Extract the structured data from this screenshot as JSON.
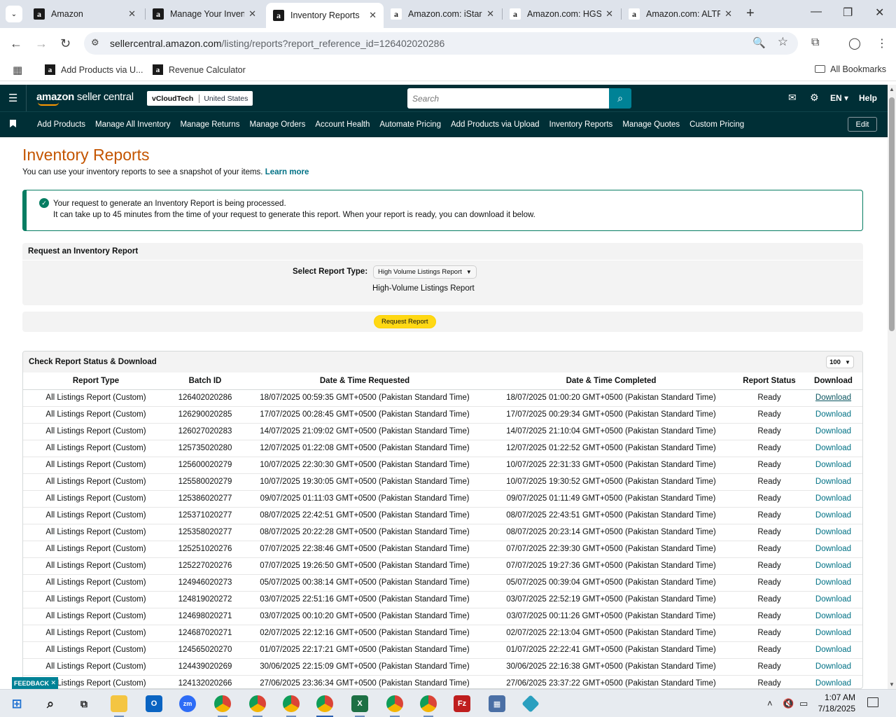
{
  "browser": {
    "tabs": [
      {
        "label": "Amazon",
        "active": false
      },
      {
        "label": "Manage Your Inventory",
        "active": false
      },
      {
        "label": "Inventory Reports",
        "active": true
      },
      {
        "label": "Amazon.com: iStar",
        "active": false
      },
      {
        "label": "Amazon.com: HGS",
        "active": false
      },
      {
        "label": "Amazon.com: ALTR",
        "active": false
      }
    ],
    "url_domain": "sellercentral.amazon.com",
    "url_path": "/listing/reports?report_reference_id=126402020286",
    "bookmarks": [
      "Add Products via U...",
      "Revenue Calculator"
    ],
    "all_bookmarks": "All Bookmarks"
  },
  "header": {
    "logo_bold": "amazon",
    "logo_thin": " seller central",
    "account_name": "vCloudTech",
    "marketplace": "United States",
    "search_placeholder": "Search",
    "language": "EN",
    "help": "Help"
  },
  "nav": {
    "items": [
      "Add Products",
      "Manage All Inventory",
      "Manage Returns",
      "Manage Orders",
      "Account Health",
      "Automate Pricing",
      "Add Products via Upload",
      "Inventory Reports",
      "Manage Quotes",
      "Custom Pricing"
    ],
    "edit": "Edit"
  },
  "page": {
    "title": "Inventory Reports",
    "subtitle": "You can use your inventory reports to see a snapshot of your items.",
    "learn_more": "Learn more",
    "alert_line1": "Your request to generate an Inventory Report is being processed.",
    "alert_line2": "It can take up to 45 minutes from the time of your request to generate this report. When your report is ready, you can download it below.",
    "request_heading": "Request an Inventory Report",
    "select_label": "Select Report Type:",
    "select_value": "High Volume Listings Report",
    "report_description": "High-Volume Listings Report",
    "request_button": "Request Report",
    "status_heading": "Check Report Status & Download",
    "page_size": "100",
    "feedback": "FEEDBACK"
  },
  "table": {
    "columns": [
      "Report Type",
      "Batch ID",
      "Date & Time Requested",
      "Date & Time Completed",
      "Report Status",
      "Download"
    ],
    "rows": [
      [
        "All Listings Report (Custom)",
        "126402020286",
        "18/07/2025 00:59:35 GMT+0500 (Pakistan Standard Time)",
        "18/07/2025 01:00:20 GMT+0500 (Pakistan Standard Time)",
        "Ready",
        "Download"
      ],
      [
        "All Listings Report (Custom)",
        "126290020285",
        "17/07/2025 00:28:45 GMT+0500 (Pakistan Standard Time)",
        "17/07/2025 00:29:34 GMT+0500 (Pakistan Standard Time)",
        "Ready",
        "Download"
      ],
      [
        "All Listings Report (Custom)",
        "126027020283",
        "14/07/2025 21:09:02 GMT+0500 (Pakistan Standard Time)",
        "14/07/2025 21:10:04 GMT+0500 (Pakistan Standard Time)",
        "Ready",
        "Download"
      ],
      [
        "All Listings Report (Custom)",
        "125735020280",
        "12/07/2025 01:22:08 GMT+0500 (Pakistan Standard Time)",
        "12/07/2025 01:22:52 GMT+0500 (Pakistan Standard Time)",
        "Ready",
        "Download"
      ],
      [
        "All Listings Report (Custom)",
        "125600020279",
        "10/07/2025 22:30:30 GMT+0500 (Pakistan Standard Time)",
        "10/07/2025 22:31:33 GMT+0500 (Pakistan Standard Time)",
        "Ready",
        "Download"
      ],
      [
        "All Listings Report (Custom)",
        "125580020279",
        "10/07/2025 19:30:05 GMT+0500 (Pakistan Standard Time)",
        "10/07/2025 19:30:52 GMT+0500 (Pakistan Standard Time)",
        "Ready",
        "Download"
      ],
      [
        "All Listings Report (Custom)",
        "125386020277",
        "09/07/2025 01:11:03 GMT+0500 (Pakistan Standard Time)",
        "09/07/2025 01:11:49 GMT+0500 (Pakistan Standard Time)",
        "Ready",
        "Download"
      ],
      [
        "All Listings Report (Custom)",
        "125371020277",
        "08/07/2025 22:42:51 GMT+0500 (Pakistan Standard Time)",
        "08/07/2025 22:43:51 GMT+0500 (Pakistan Standard Time)",
        "Ready",
        "Download"
      ],
      [
        "All Listings Report (Custom)",
        "125358020277",
        "08/07/2025 20:22:28 GMT+0500 (Pakistan Standard Time)",
        "08/07/2025 20:23:14 GMT+0500 (Pakistan Standard Time)",
        "Ready",
        "Download"
      ],
      [
        "All Listings Report (Custom)",
        "125251020276",
        "07/07/2025 22:38:46 GMT+0500 (Pakistan Standard Time)",
        "07/07/2025 22:39:30 GMT+0500 (Pakistan Standard Time)",
        "Ready",
        "Download"
      ],
      [
        "All Listings Report (Custom)",
        "125227020276",
        "07/07/2025 19:26:50 GMT+0500 (Pakistan Standard Time)",
        "07/07/2025 19:27:36 GMT+0500 (Pakistan Standard Time)",
        "Ready",
        "Download"
      ],
      [
        "All Listings Report (Custom)",
        "124946020273",
        "05/07/2025 00:38:14 GMT+0500 (Pakistan Standard Time)",
        "05/07/2025 00:39:04 GMT+0500 (Pakistan Standard Time)",
        "Ready",
        "Download"
      ],
      [
        "All Listings Report (Custom)",
        "124819020272",
        "03/07/2025 22:51:16 GMT+0500 (Pakistan Standard Time)",
        "03/07/2025 22:52:19 GMT+0500 (Pakistan Standard Time)",
        "Ready",
        "Download"
      ],
      [
        "All Listings Report (Custom)",
        "124698020271",
        "03/07/2025 00:10:20 GMT+0500 (Pakistan Standard Time)",
        "03/07/2025 00:11:26 GMT+0500 (Pakistan Standard Time)",
        "Ready",
        "Download"
      ],
      [
        "All Listings Report (Custom)",
        "124687020271",
        "02/07/2025 22:12:16 GMT+0500 (Pakistan Standard Time)",
        "02/07/2025 22:13:04 GMT+0500 (Pakistan Standard Time)",
        "Ready",
        "Download"
      ],
      [
        "All Listings Report (Custom)",
        "124565020270",
        "01/07/2025 22:17:21 GMT+0500 (Pakistan Standard Time)",
        "01/07/2025 22:22:41 GMT+0500 (Pakistan Standard Time)",
        "Ready",
        "Download"
      ],
      [
        "All Listings Report (Custom)",
        "124439020269",
        "30/06/2025 22:15:09 GMT+0500 (Pakistan Standard Time)",
        "30/06/2025 22:16:38 GMT+0500 (Pakistan Standard Time)",
        "Ready",
        "Download"
      ],
      [
        "All Listings Report (Custom)",
        "124132020266",
        "27/06/2025 23:36:34 GMT+0500 (Pakistan Standard Time)",
        "27/06/2025 23:37:22 GMT+0500 (Pakistan Standard Time)",
        "Ready",
        "Download"
      ]
    ]
  },
  "taskbar": {
    "time": "1:07 AM",
    "date": "7/18/2025",
    "apps": [
      "start-icon",
      "search-icon",
      "task-view-icon",
      "file-explorer-icon",
      "outlook-icon",
      "zoom-icon",
      "chrome-icon",
      "chrome-icon",
      "chrome-icon",
      "chrome-icon",
      "excel-icon",
      "chrome-icon",
      "chrome-icon",
      "filezilla-icon",
      "calculator-icon",
      "app-icon"
    ]
  },
  "colors": {
    "header_bg": "#002f36",
    "title_orange": "#c45500",
    "link_teal": "#007185",
    "alert_green": "#067d62",
    "button_yellow": "#ffd814"
  }
}
